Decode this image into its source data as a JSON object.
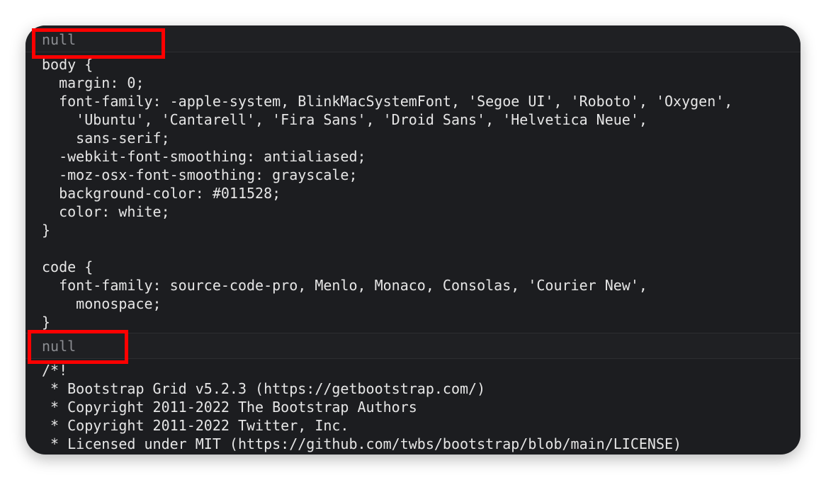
{
  "sections": [
    {
      "header": "null",
      "lines": [
        "body {",
        "  margin: 0;",
        "  font-family: -apple-system, BlinkMacSystemFont, 'Segoe UI', 'Roboto', 'Oxygen',",
        "    'Ubuntu', 'Cantarell', 'Fira Sans', 'Droid Sans', 'Helvetica Neue',",
        "    sans-serif;",
        "  -webkit-font-smoothing: antialiased;",
        "  -moz-osx-font-smoothing: grayscale;",
        "  background-color: #011528;",
        "  color: white;",
        "}",
        "",
        "code {",
        "  font-family: source-code-pro, Menlo, Monaco, Consolas, 'Courier New',",
        "    monospace;",
        "}"
      ]
    },
    {
      "header": "null",
      "lines": [
        "/*!",
        " * Bootstrap Grid v5.2.3 (https://getbootstrap.com/)",
        " * Copyright 2011-2022 The Bootstrap Authors",
        " * Copyright 2011-2022 Twitter, Inc.",
        " * Licensed under MIT (https://github.com/twbs/bootstrap/blob/main/LICENSE)"
      ]
    }
  ],
  "colors": {
    "panel_background": "#1c1d20",
    "header_background": "#1f2023",
    "code_text": "#e6e6e6",
    "null_text": "#8b8d92",
    "highlight": "#ff0000"
  }
}
